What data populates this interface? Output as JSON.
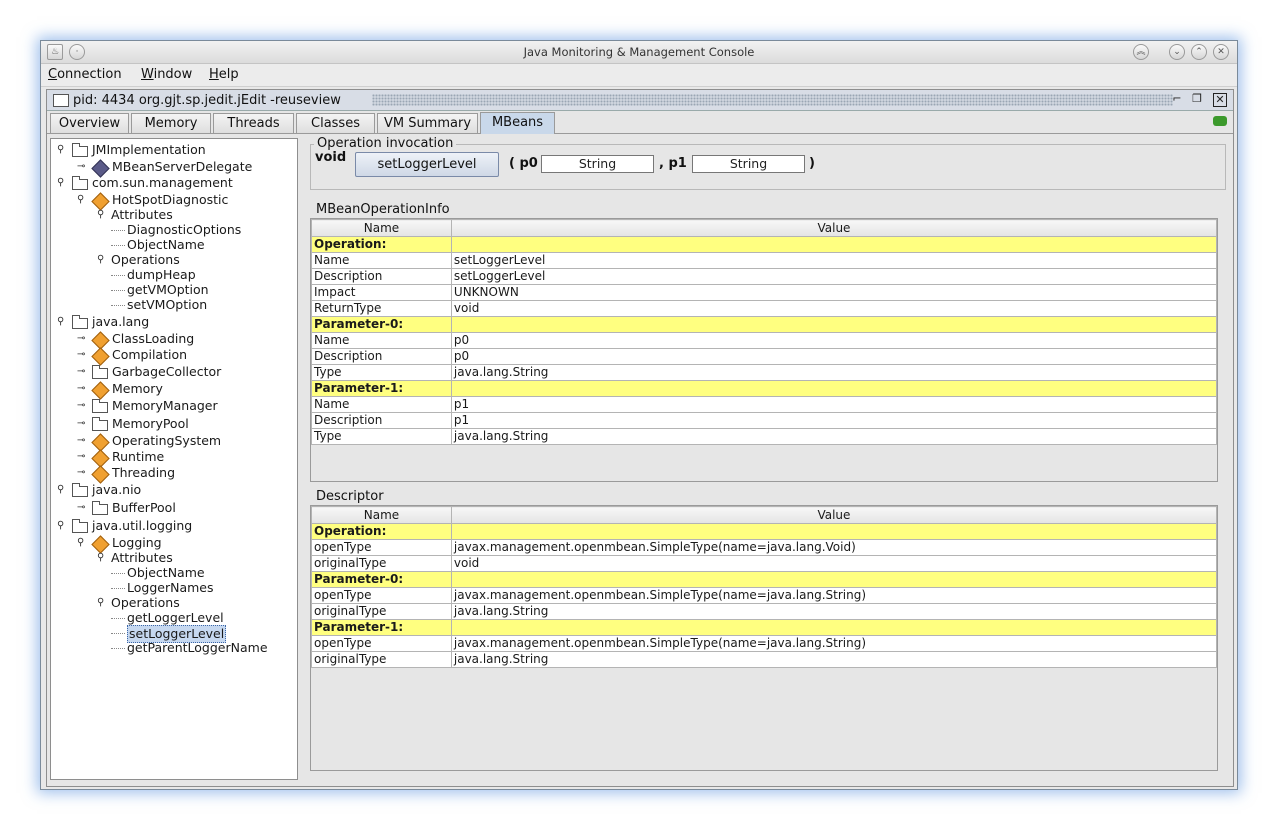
{
  "window": {
    "title": "Java Monitoring & Management Console"
  },
  "menu": [
    {
      "pre": "",
      "u": "C",
      "post": "onnection"
    },
    {
      "pre": "",
      "u": "W",
      "post": "indow"
    },
    {
      "pre": "",
      "u": "H",
      "post": "elp"
    }
  ],
  "frame": {
    "title": "pid: 4434 org.gjt.sp.jedit.jEdit -reuseview"
  },
  "tabs": [
    "Overview",
    "Memory",
    "Threads",
    "Classes",
    "VM Summary",
    "MBeans"
  ],
  "active_tab": "MBeans",
  "tree": [
    {
      "label": "JMImplementation",
      "icon": "folder",
      "level": 0
    },
    {
      "label": "MBeanServerDelegate",
      "icon": "bean-dark",
      "level": 1
    },
    {
      "label": "com.sun.management",
      "icon": "folder",
      "level": 0
    },
    {
      "label": "HotSpotDiagnostic",
      "icon": "bean",
      "level": 1
    },
    {
      "label": "Attributes",
      "icon": "none",
      "level": 2
    },
    {
      "label": "DiagnosticOptions",
      "icon": "none",
      "level": 3
    },
    {
      "label": "ObjectName",
      "icon": "none",
      "level": 3
    },
    {
      "label": "Operations",
      "icon": "none",
      "level": 2
    },
    {
      "label": "dumpHeap",
      "icon": "none",
      "level": 3
    },
    {
      "label": "getVMOption",
      "icon": "none",
      "level": 3
    },
    {
      "label": "setVMOption",
      "icon": "none",
      "level": 3
    },
    {
      "label": "java.lang",
      "icon": "folder",
      "level": 0
    },
    {
      "label": "ClassLoading",
      "icon": "bean",
      "level": 1
    },
    {
      "label": "Compilation",
      "icon": "bean",
      "level": 1
    },
    {
      "label": "GarbageCollector",
      "icon": "folder",
      "level": 1
    },
    {
      "label": "Memory",
      "icon": "bean",
      "level": 1
    },
    {
      "label": "MemoryManager",
      "icon": "folder",
      "level": 1
    },
    {
      "label": "MemoryPool",
      "icon": "folder",
      "level": 1
    },
    {
      "label": "OperatingSystem",
      "icon": "bean",
      "level": 1
    },
    {
      "label": "Runtime",
      "icon": "bean",
      "level": 1
    },
    {
      "label": "Threading",
      "icon": "bean",
      "level": 1
    },
    {
      "label": "java.nio",
      "icon": "folder",
      "level": 0
    },
    {
      "label": "BufferPool",
      "icon": "folder",
      "level": 1
    },
    {
      "label": "java.util.logging",
      "icon": "folder",
      "level": 0
    },
    {
      "label": "Logging",
      "icon": "bean",
      "level": 1
    },
    {
      "label": "Attributes",
      "icon": "none",
      "level": 2
    },
    {
      "label": "ObjectName",
      "icon": "none",
      "level": 3
    },
    {
      "label": "LoggerNames",
      "icon": "none",
      "level": 3
    },
    {
      "label": "Operations",
      "icon": "none",
      "level": 2
    },
    {
      "label": "getLoggerLevel",
      "icon": "none",
      "level": 3
    },
    {
      "label": "setLoggerLevel",
      "icon": "none",
      "level": 3,
      "selected": true
    },
    {
      "label": "getParentLoggerName",
      "icon": "none",
      "level": 3
    }
  ],
  "invocation": {
    "title": "Operation invocation",
    "return_type": "void",
    "button": "setLoggerLevel",
    "open": "( p0",
    "p0_value": "String",
    "sep": ", p1",
    "p1_value": "String",
    "close": ")"
  },
  "opinfo": {
    "title": "MBeanOperationInfo",
    "columns": [
      "Name",
      "Value"
    ],
    "rows": [
      {
        "name": "Operation:",
        "value": "",
        "header": true
      },
      {
        "name": "Name",
        "value": "setLoggerLevel"
      },
      {
        "name": "Description",
        "value": "setLoggerLevel"
      },
      {
        "name": "Impact",
        "value": "UNKNOWN"
      },
      {
        "name": "ReturnType",
        "value": "void"
      },
      {
        "name": "Parameter-0:",
        "value": "",
        "header": true
      },
      {
        "name": "Name",
        "value": "p0"
      },
      {
        "name": "Description",
        "value": "p0"
      },
      {
        "name": "Type",
        "value": "java.lang.String"
      },
      {
        "name": "Parameter-1:",
        "value": "",
        "header": true
      },
      {
        "name": "Name",
        "value": "p1"
      },
      {
        "name": "Description",
        "value": "p1"
      },
      {
        "name": "Type",
        "value": "java.lang.String"
      }
    ]
  },
  "descriptor": {
    "title": "Descriptor",
    "columns": [
      "Name",
      "Value"
    ],
    "rows": [
      {
        "name": "Operation:",
        "value": "",
        "header": true
      },
      {
        "name": "openType",
        "value": "javax.management.openmbean.SimpleType(name=java.lang.Void)"
      },
      {
        "name": "originalType",
        "value": "void"
      },
      {
        "name": "Parameter-0:",
        "value": "",
        "header": true
      },
      {
        "name": "openType",
        "value": "javax.management.openmbean.SimpleType(name=java.lang.String)"
      },
      {
        "name": "originalType",
        "value": "java.lang.String"
      },
      {
        "name": "Parameter-1:",
        "value": "",
        "header": true
      },
      {
        "name": "openType",
        "value": "javax.management.openmbean.SimpleType(name=java.lang.String)"
      },
      {
        "name": "originalType",
        "value": "java.lang.String"
      }
    ]
  },
  "colors": {
    "header_row": "#ffff80",
    "selection": "#c6d8f0",
    "active_tab": "#c9d8ea"
  }
}
